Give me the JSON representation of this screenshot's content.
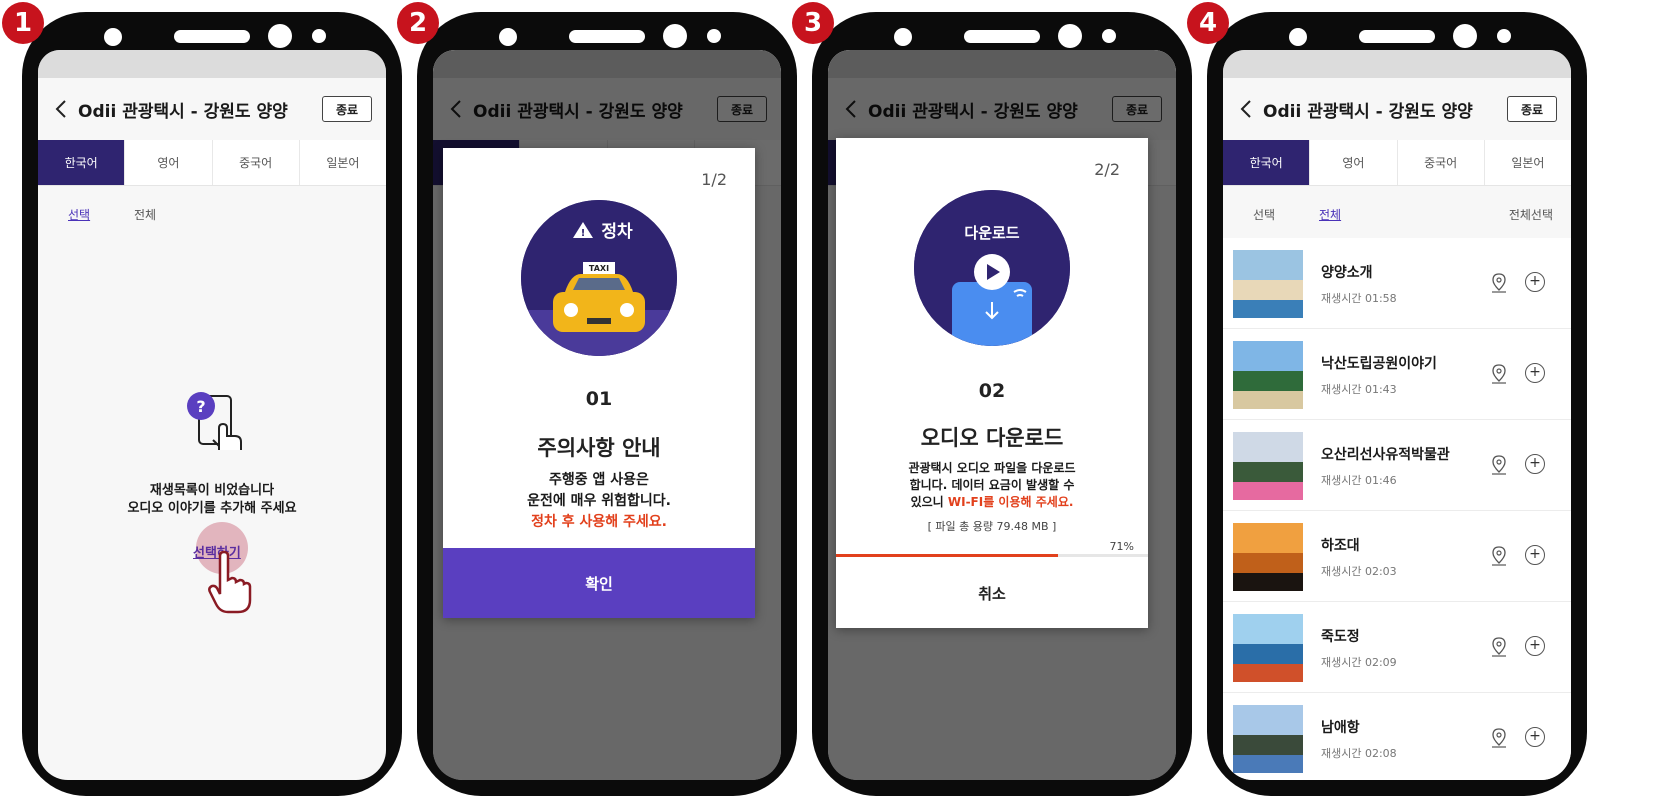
{
  "steps": [
    "1",
    "2",
    "3",
    "4"
  ],
  "header": {
    "title": "Odii 관광택시 - 강원도 양양",
    "end_label": "종료"
  },
  "tabs": [
    "한국어",
    "영어",
    "중국어",
    "일본어"
  ],
  "subtabs": {
    "select": "선택",
    "all": "전체",
    "select_all": "전체선택"
  },
  "empty": {
    "line1": "재생목록이 비었습니다",
    "line2": "오디오 이야기를 추가해 주세요",
    "select_link": "선택하기"
  },
  "modal1": {
    "page": "1/2",
    "badge": "정차",
    "taxi": "TAXI",
    "number": "01",
    "heading": "주의사항 안내",
    "body1": "주행중 앱 사용은",
    "body2": "운전에 매우 위험합니다.",
    "warning": "정차 후 사용해 주세요.",
    "confirm": "확인"
  },
  "modal2": {
    "page": "2/2",
    "badge": "다운로드",
    "number": "02",
    "heading": "오디오 다운로드",
    "body1": "관광택시 오디오 파일을 다운로드",
    "body2": "합니다. 데이터 요금이 발생할 수",
    "body3": "있으니 ",
    "warning": "WI-FI를 이용해 주세요.",
    "filesize": "[ 파일 총 용량 79.48 MB ]",
    "progress_label": "71%",
    "progress": 0.71,
    "cancel": "취소"
  },
  "list": [
    {
      "title": "양양소개",
      "time": "재생시간 01:58"
    },
    {
      "title": "낙산도립공원이야기",
      "time": "재생시간 01:43"
    },
    {
      "title": "오산리선사유적박물관",
      "time": "재생시간 01:46"
    },
    {
      "title": "하조대",
      "time": "재생시간 02:03"
    },
    {
      "title": "죽도정",
      "time": "재생시간 02:09"
    },
    {
      "title": "남애항",
      "time": "재생시간 02:08"
    }
  ],
  "colors": {
    "accent": "#2f2470",
    "confirm": "#5a3fc0",
    "warning": "#e2401c",
    "step": "#c7131d"
  }
}
